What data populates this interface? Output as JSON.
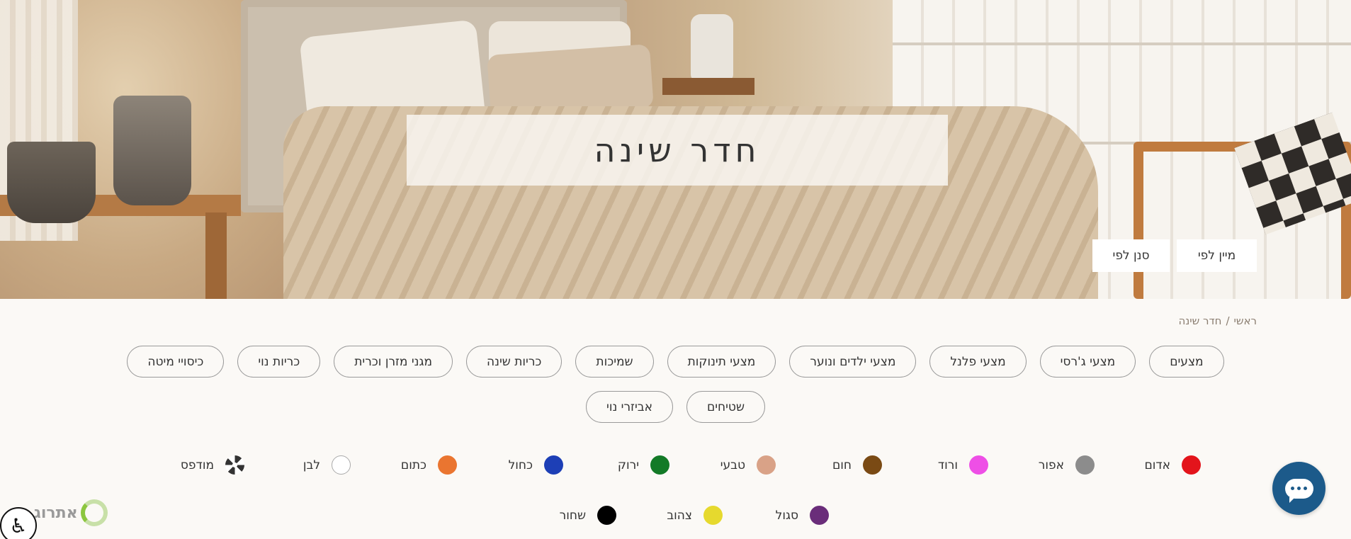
{
  "hero": {
    "title": "חדר שינה",
    "sort_label": "מיין לפי",
    "filter_label": "סנן לפי"
  },
  "breadcrumb": {
    "home": "ראשי",
    "separator": "/",
    "current": "חדר שינה"
  },
  "categories": [
    "מצעים",
    "מצעי ג'רסי",
    "מצעי פלנל",
    "מצעי ילדים ונוער",
    "מצעי תינוקות",
    "שמיכות",
    "כריות שינה",
    "מגני מזרן וכרית",
    "כריות נוי",
    "כיסויי מיטה",
    "שטיחים",
    "אביזרי נוי"
  ],
  "colors": [
    {
      "label": "אדום",
      "hex": "#e3141b"
    },
    {
      "label": "אפור",
      "hex": "#8c8c8c"
    },
    {
      "label": "ורוד",
      "hex": "#ee4fe6"
    },
    {
      "label": "חום",
      "hex": "#7a4a14"
    },
    {
      "label": "טבעי",
      "hex": "#d9a287"
    },
    {
      "label": "ירוק",
      "hex": "#137a27"
    },
    {
      "label": "כחול",
      "hex": "#1d3fb6"
    },
    {
      "label": "כתום",
      "hex": "#ea7530"
    },
    {
      "label": "לבן",
      "hex": "#ffffff"
    },
    {
      "label": "מודפס",
      "hex": "print"
    },
    {
      "label": "סגול",
      "hex": "#6a2d7a"
    },
    {
      "label": "צהוב",
      "hex": "#e6d92e"
    },
    {
      "label": "שחור",
      "hex": "#000000"
    }
  ],
  "widgets": {
    "chat_icon": "chat-bubble-icon",
    "accessibility_icon": "wheelchair-icon",
    "logo_text": "אתרוג"
  }
}
